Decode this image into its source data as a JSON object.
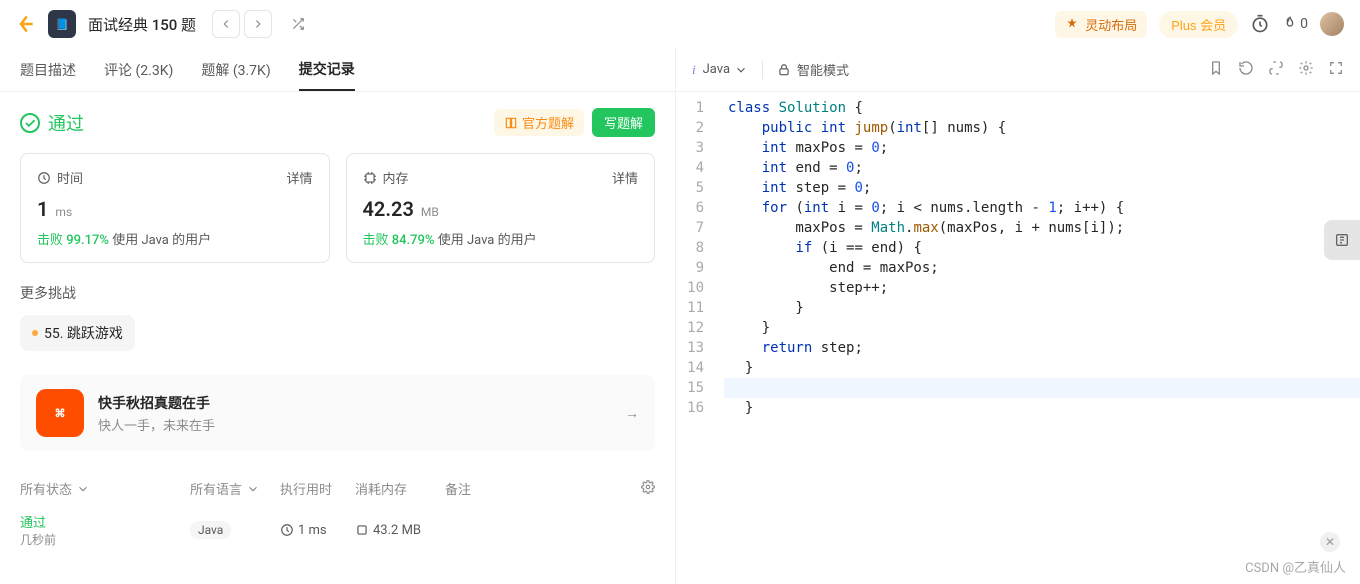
{
  "header": {
    "title": "面试经典 150 题",
    "flex_layout": "灵动布局",
    "plus": "Plus 会员",
    "streak_count": "0"
  },
  "tabs": [
    "题目描述",
    "评论 (2.3K)",
    "题解 (3.7K)",
    "提交记录"
  ],
  "active_tab": 3,
  "status": {
    "pass_label": "通过",
    "official_solution": "官方题解",
    "write_solution": "写题解"
  },
  "stats": {
    "time": {
      "label": "时间",
      "detail": "详情",
      "value": "1",
      "unit": "ms",
      "beat_prefix": "击败",
      "beat_pct": "99.17%",
      "beat_suffix": "使用 Java 的用户"
    },
    "memory": {
      "label": "内存",
      "detail": "详情",
      "value": "42.23",
      "unit": "MB",
      "beat_prefix": "击败",
      "beat_pct": "84.79%",
      "beat_suffix": "使用 Java 的用户"
    }
  },
  "more_challenges_label": "更多挑战",
  "challenge": "55. 跳跃游戏",
  "promo": {
    "title": "快手秋招真题在手",
    "subtitle": "快人一手，未来在手"
  },
  "table": {
    "headers": {
      "status": "所有状态",
      "lang": "所有语言",
      "runtime": "执行用时",
      "memory": "消耗内存",
      "note": "备注"
    },
    "row": {
      "status": "通过",
      "time_ago": "几秒前",
      "lang": "Java",
      "runtime": "1 ms",
      "memory": "43.2 MB"
    }
  },
  "editor": {
    "lang": "Java",
    "smart_mode": "智能模式"
  },
  "code_lines": [
    "class Solution {",
    "    public int jump(int[] nums) {",
    "    int maxPos = 0;",
    "    int end = 0;",
    "    int step = 0;",
    "    for (int i = 0; i < nums.length - 1; i++) {",
    "        maxPos = Math.max(maxPos, i + nums[i]);",
    "        if (i == end) {",
    "            end = maxPos;",
    "            step++;",
    "        }",
    "    }",
    "    return step;",
    "  }",
    "",
    "  }"
  ],
  "watermark": "CSDN @乙真仙人"
}
